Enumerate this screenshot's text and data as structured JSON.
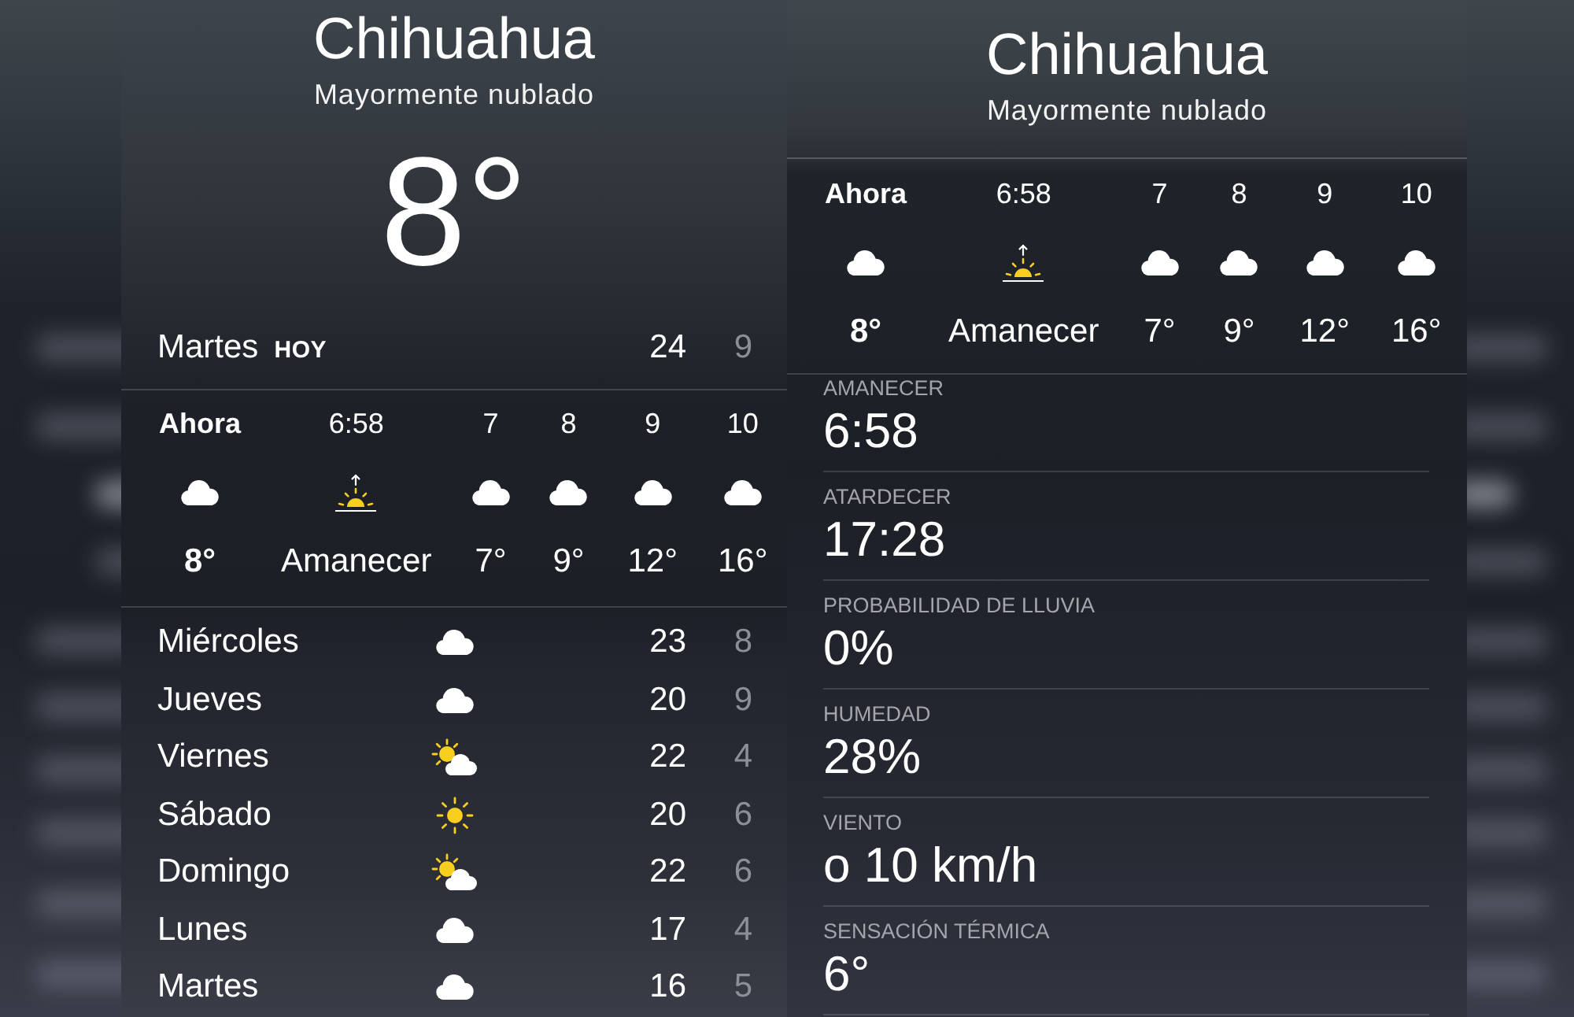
{
  "panels": [
    {
      "location": "Chihuahua",
      "condition": "Mayormente nublado",
      "current_temp": "8°",
      "today": {
        "day": "Martes",
        "badge": "HOY",
        "high": "24",
        "low": "9"
      },
      "hourly": [
        {
          "time": "Ahora",
          "kind": "cloud",
          "reading": "8°",
          "current": true
        },
        {
          "time": "6:58",
          "kind": "sunrise",
          "reading": "Amanecer",
          "current": false
        },
        {
          "time": "7",
          "kind": "cloud",
          "reading": "7°",
          "current": false
        },
        {
          "time": "8",
          "kind": "cloud",
          "reading": "9°",
          "current": false
        },
        {
          "time": "9",
          "kind": "cloud",
          "reading": "12°",
          "current": false
        },
        {
          "time": "10",
          "kind": "cloud",
          "reading": "16°",
          "current": false
        }
      ],
      "daily": [
        {
          "day": "Miércoles",
          "kind": "cloud",
          "high": "23",
          "low": "8"
        },
        {
          "day": "Jueves",
          "kind": "cloud",
          "high": "20",
          "low": "9"
        },
        {
          "day": "Viernes",
          "kind": "partly-sunny",
          "high": "22",
          "low": "4"
        },
        {
          "day": "Sábado",
          "kind": "sun",
          "high": "20",
          "low": "6"
        },
        {
          "day": "Domingo",
          "kind": "partly-sunny",
          "high": "22",
          "low": "6"
        },
        {
          "day": "Lunes",
          "kind": "cloud",
          "high": "17",
          "low": "4"
        },
        {
          "day": "Martes",
          "kind": "cloud",
          "high": "16",
          "low": "5"
        }
      ]
    },
    {
      "location": "Chihuahua",
      "condition": "Mayormente nublado",
      "hourly": [
        {
          "time": "Ahora",
          "kind": "cloud",
          "reading": "8°",
          "current": true
        },
        {
          "time": "6:58",
          "kind": "sunrise",
          "reading": "Amanecer",
          "current": false
        },
        {
          "time": "7",
          "kind": "cloud",
          "reading": "7°",
          "current": false
        },
        {
          "time": "8",
          "kind": "cloud",
          "reading": "9°",
          "current": false
        },
        {
          "time": "9",
          "kind": "cloud",
          "reading": "12°",
          "current": false
        },
        {
          "time": "10",
          "kind": "cloud",
          "reading": "16°",
          "current": false
        }
      ],
      "details": [
        {
          "label": "AMANECER",
          "value": "6:58"
        },
        {
          "label": "ATARDECER",
          "value": "17:28"
        },
        {
          "label": "PROBABILIDAD DE LLUVIA",
          "value": "0%"
        },
        {
          "label": "HUMEDAD",
          "value": "28%"
        },
        {
          "label": "VIENTO",
          "value": "o 10 km/h"
        },
        {
          "label": "SENSACIÓN TÉRMICA",
          "value": "6°"
        }
      ]
    }
  ]
}
